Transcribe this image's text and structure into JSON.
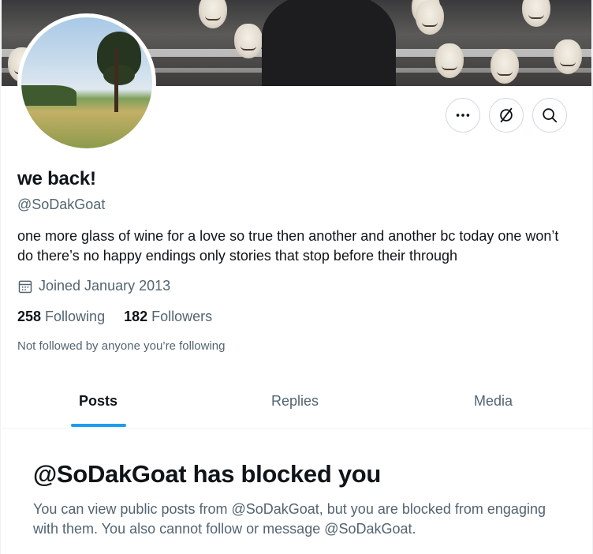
{
  "profile": {
    "display_name": "we back!",
    "handle": "@SoDakGoat",
    "bio": "one more glass of wine for a love so true then another and another bc today one won’t do there’s no happy endings only stories that stop before their through",
    "joined": "Joined January 2013",
    "following_count": "258",
    "following_label": "Following",
    "followers_count": "182",
    "followers_label": "Followers",
    "not_followed_note": "Not followed by anyone you’re following"
  },
  "actions": {
    "more_icon": "more-dots-icon",
    "grok_icon": "grok-slash-icon",
    "search_icon": "search-icon"
  },
  "tabs": [
    {
      "label": "Posts",
      "active": true
    },
    {
      "label": "Replies",
      "active": false
    },
    {
      "label": "Media",
      "active": false
    }
  ],
  "blocked": {
    "title": "@SoDakGoat has blocked you",
    "message": "You can view public posts from @SoDakGoat, but you are blocked from engaging with them. You also cannot follow or message @SoDakGoat."
  },
  "colors": {
    "accent": "#1d9bf0",
    "text_primary": "#0f1419",
    "text_secondary": "#536471",
    "border": "#cfd9de"
  }
}
